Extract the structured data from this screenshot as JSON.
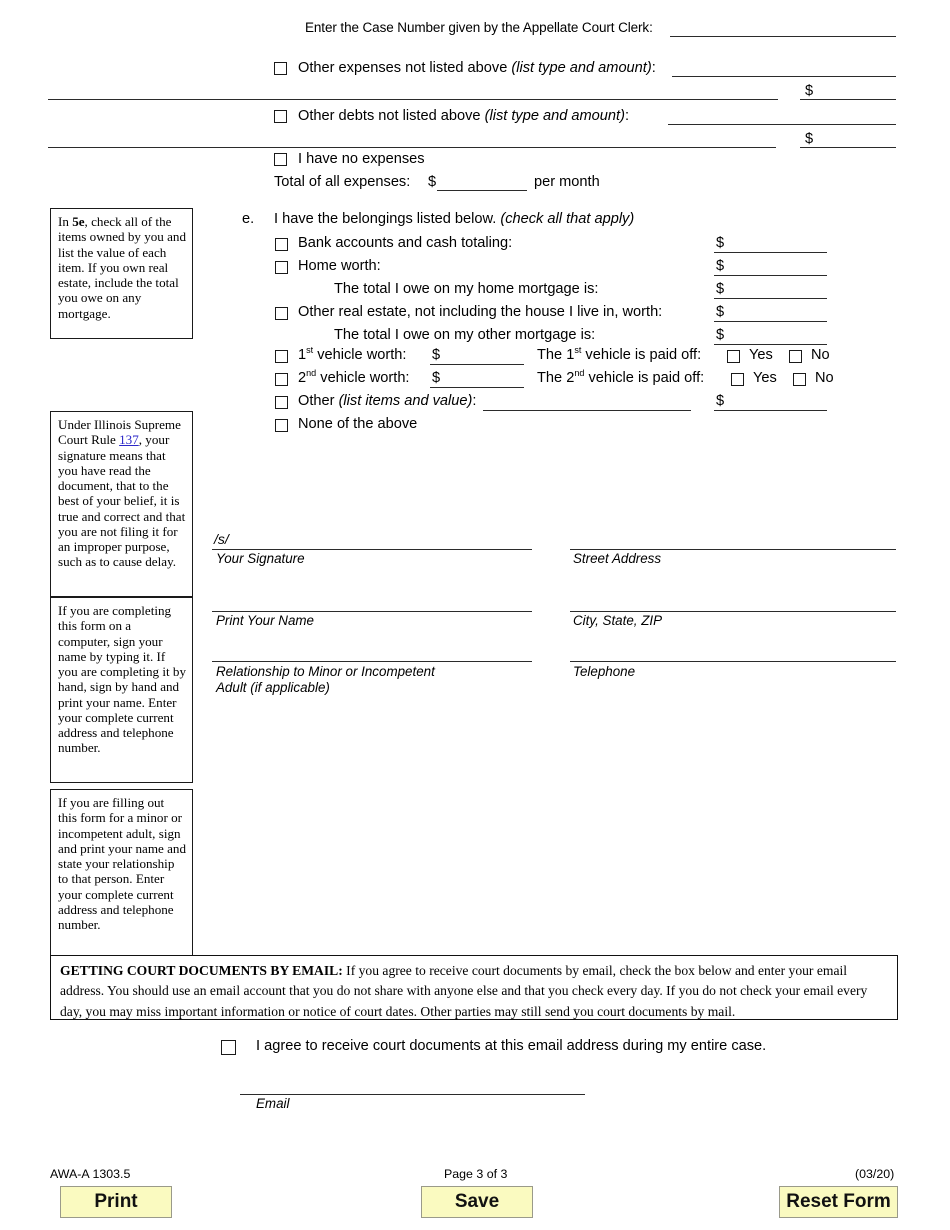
{
  "header": {
    "case_number_prompt": "Enter the Case Number given by the Appellate Court Clerk:"
  },
  "expenses": {
    "other_expenses_label": "Other expenses not listed above",
    "other_expenses_hint": "(list type and amount)",
    "other_expenses_colon": ":",
    "other_debts_label": "Other debts not listed above",
    "other_debts_hint": "(list type and amount)",
    "other_debts_colon": ":",
    "no_expenses_label": "I have no expenses",
    "total_label": "Total of all expenses:",
    "dollar": "$",
    "per_month": "per month"
  },
  "belongings": {
    "item_letter": "e.",
    "heading": "I have the belongings listed below.",
    "heading_hint": "(check all that apply)",
    "dollar": "$",
    "rows": [
      {
        "label": "Bank accounts and cash totaling:"
      },
      {
        "label": "Home worth:"
      },
      {
        "label": "The total I owe on my home mortgage is:"
      },
      {
        "label": "Other real estate, not including the house I live in, worth:"
      },
      {
        "label": "The total I owe on my other mortgage is:"
      }
    ],
    "vehicle1_worth_label": "vehicle worth:",
    "vehicle1_ordinal": "1",
    "vehicle1_ordinal_sup": "st",
    "vehicle2_worth_label": "vehicle worth:",
    "vehicle2_ordinal": "2",
    "vehicle2_ordinal_sup": "nd",
    "vehicle1_paidoff_pre": "The 1",
    "vehicle1_paidoff_sup": "st",
    "vehicle1_paidoff_post": " vehicle is paid off:",
    "vehicle2_paidoff_pre": "The 2",
    "vehicle2_paidoff_sup": "nd",
    "vehicle2_paidoff_post": " vehicle is paid off:",
    "yes_label": "Yes",
    "no_label": "No",
    "other_label": "Other",
    "other_hint": "(list items and value)",
    "other_colon": ":",
    "none_label": "None of the above"
  },
  "sidebar": {
    "box_5e_pre": "In ",
    "box_5e_bold": "5e",
    "box_5e_post": ", check all of the items owned by you and list the value of each item. If you own real estate, include the total you owe on any mortgage.",
    "box_rule_pre": "Under Illinois Supreme Court Rule ",
    "box_rule_link": "137",
    "box_rule_post": ", your signature means that you have read the document, that to the best of your belief, it is true and correct and that you are not filing it for an improper purpose, such as to cause delay.",
    "box_signing": "If you are completing this form on a computer, sign your name by typing it.  If you are completing it by hand, sign by hand and print your name. Enter your complete current address and telephone number.",
    "box_minor": "If you are filling out this form for a minor or incompetent adult, sign and print your name and state your relationship to that person. Enter your complete current address and telephone number."
  },
  "signature": {
    "s_mark": "/s/",
    "your_signature": "Your Signature",
    "print_your_name": "Print Your Name",
    "relationship_line1": "Relationship to Minor or Incompetent",
    "relationship_line2": "Adult (if applicable)",
    "street_address": "Street Address",
    "city_state_zip": "City, State, ZIP",
    "telephone": "Telephone"
  },
  "email_notice": {
    "lead": "GETTING COURT DOCUMENTS BY EMAIL:",
    "body": " If you agree to receive court documents by email, check the box below and enter your email address.  You should use an email account that you do not share with anyone else and that you check every day. If you do not check your email every day, you may miss important information or notice of court dates.  Other parties may still send you court documents by mail.",
    "agree_label": "I agree to receive court documents at this email address during my entire case.",
    "email_field_label": "Email"
  },
  "footer": {
    "form_number": "AWA-A 1303.5",
    "page_number": "Page 3 of 3",
    "revision_date": "(03/20)",
    "print_button": "Print",
    "save_button": "Save",
    "reset_button": "Reset Form"
  },
  "colors": {
    "button_bg": "#FAFAC0",
    "button_border": "#9a9a8a",
    "link": "#2b27c8",
    "rule": "#2b2b2b"
  }
}
